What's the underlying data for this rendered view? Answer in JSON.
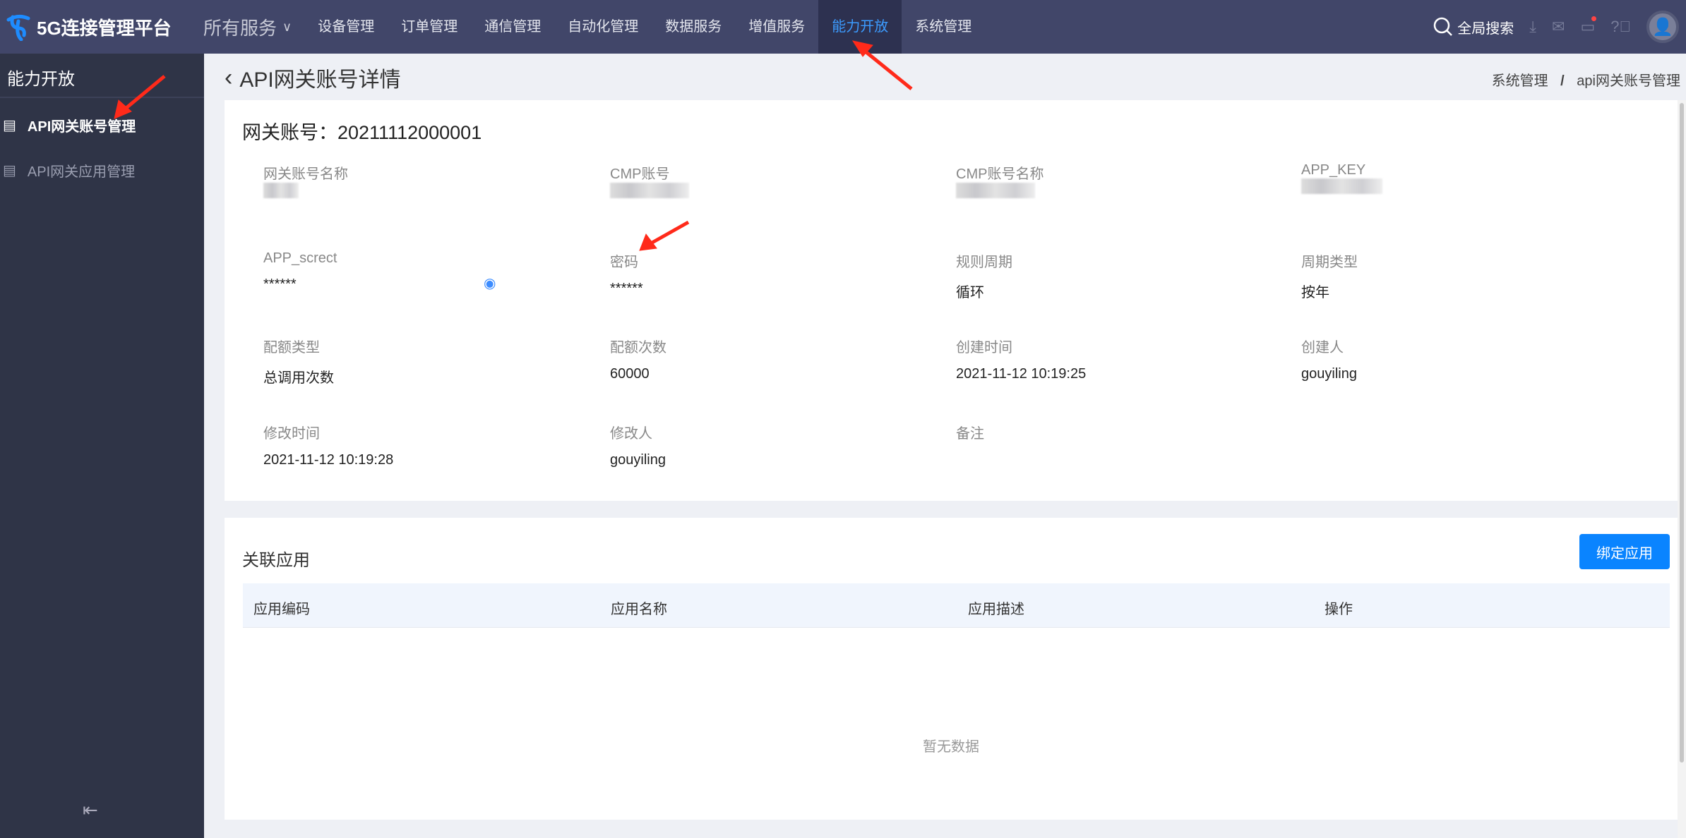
{
  "header": {
    "logo_text": "5G连接管理平台",
    "all_services": "所有服务",
    "nav": [
      "设备管理",
      "订单管理",
      "通信管理",
      "自动化管理",
      "数据服务",
      "增值服务",
      "能力开放",
      "系统管理"
    ],
    "active_nav": "能力开放",
    "search_label": "全局搜索",
    "icons": [
      "search-icon",
      "download-icon",
      "mail-icon",
      "monitor-icon",
      "help-icon",
      "user-avatar-icon"
    ]
  },
  "sidebar": {
    "title": "能力开放",
    "items": [
      {
        "label": "API网关账号管理",
        "active": true
      },
      {
        "label": "API网关应用管理",
        "active": false
      }
    ]
  },
  "page": {
    "title": "API网关账号详情",
    "breadcrumb": [
      "系统管理",
      "/",
      "api网关账号管理"
    ]
  },
  "account": {
    "heading": "网关账号：20211112000001",
    "fields": [
      {
        "label": "网关账号名称",
        "value": ""
      },
      {
        "label": "CMP账号",
        "value": ""
      },
      {
        "label": "CMP账号名称",
        "value": ""
      },
      {
        "label": "APP_KEY",
        "value": ""
      },
      {
        "label": "APP_screct",
        "value": "******"
      },
      {
        "label": "密码",
        "value": "******"
      },
      {
        "label": "规则周期",
        "value": "循环"
      },
      {
        "label": "周期类型",
        "value": "按年"
      },
      {
        "label": "配额类型",
        "value": "总调用次数"
      },
      {
        "label": "配额次数",
        "value": "60000"
      },
      {
        "label": "创建时间",
        "value": "2021-11-12 10:19:25"
      },
      {
        "label": "创建人",
        "value": "gouyiling"
      },
      {
        "label": "修改时间",
        "value": "2021-11-12 10:19:28"
      },
      {
        "label": "修改人",
        "value": "gouyiling"
      },
      {
        "label": "备注",
        "value": ""
      }
    ]
  },
  "apps": {
    "title": "关联应用",
    "bind_button": "绑定应用",
    "columns": [
      "应用编码",
      "应用名称",
      "应用描述",
      "操作"
    ],
    "empty_text": "暂无数据"
  },
  "colors": {
    "topbar": "#414669",
    "sidebar": "#2f3447",
    "accent": "#0a84ff",
    "active_nav": "#3c9bff",
    "annotation": "#ff2a1a"
  }
}
